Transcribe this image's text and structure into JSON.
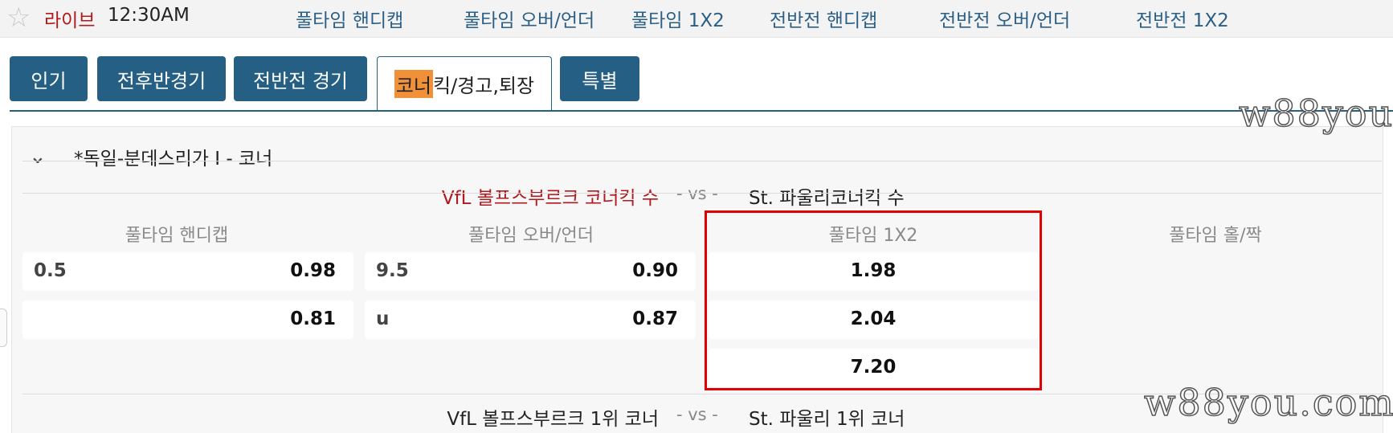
{
  "topbar": {
    "live_label": "라이브",
    "time": "12:30AM",
    "nav": [
      "풀타임 핸디캡",
      "풀타임 오버/언더",
      "풀타임 1X2",
      "전반전 핸디캡",
      "전반전 오버/언더",
      "전반전 1X2"
    ]
  },
  "tabs": [
    {
      "label": "인기"
    },
    {
      "label": "전후반경기"
    },
    {
      "label": "전반전 경기"
    },
    {
      "highlight": "코너",
      "rest": "킥/경고,퇴장"
    },
    {
      "label": "특별"
    }
  ],
  "watermark": "w88you.com",
  "league": {
    "title": "*독일-분데스리가 I - 코너"
  },
  "match1": {
    "home": "VfL 볼프스부르크 코너킥 수",
    "vs": "- vs -",
    "away": "St. 파울리코너킥 수"
  },
  "columns": [
    "풀타임 핸디캡",
    "풀타임 오버/언더",
    "풀타임 1X2",
    "풀타임 홀/짝"
  ],
  "handicap": [
    {
      "line": "0.5",
      "odds": "0.98"
    },
    {
      "line": "",
      "odds": "0.81"
    }
  ],
  "overunder": [
    {
      "line": "9.5",
      "odds": "0.90"
    },
    {
      "line": "u",
      "odds": "0.87"
    }
  ],
  "onextwo": [
    "1.98",
    "2.04",
    "7.20"
  ],
  "match2": {
    "home": "VfL 볼프스부르크 1위 코너",
    "vs": "- vs -",
    "away": "St. 파울리 1위 코너"
  },
  "colors": {
    "tab_bg": "#255f84",
    "live_red": "#b0191e",
    "highlight_orange": "#f0913a",
    "box_red": "#e00000"
  }
}
